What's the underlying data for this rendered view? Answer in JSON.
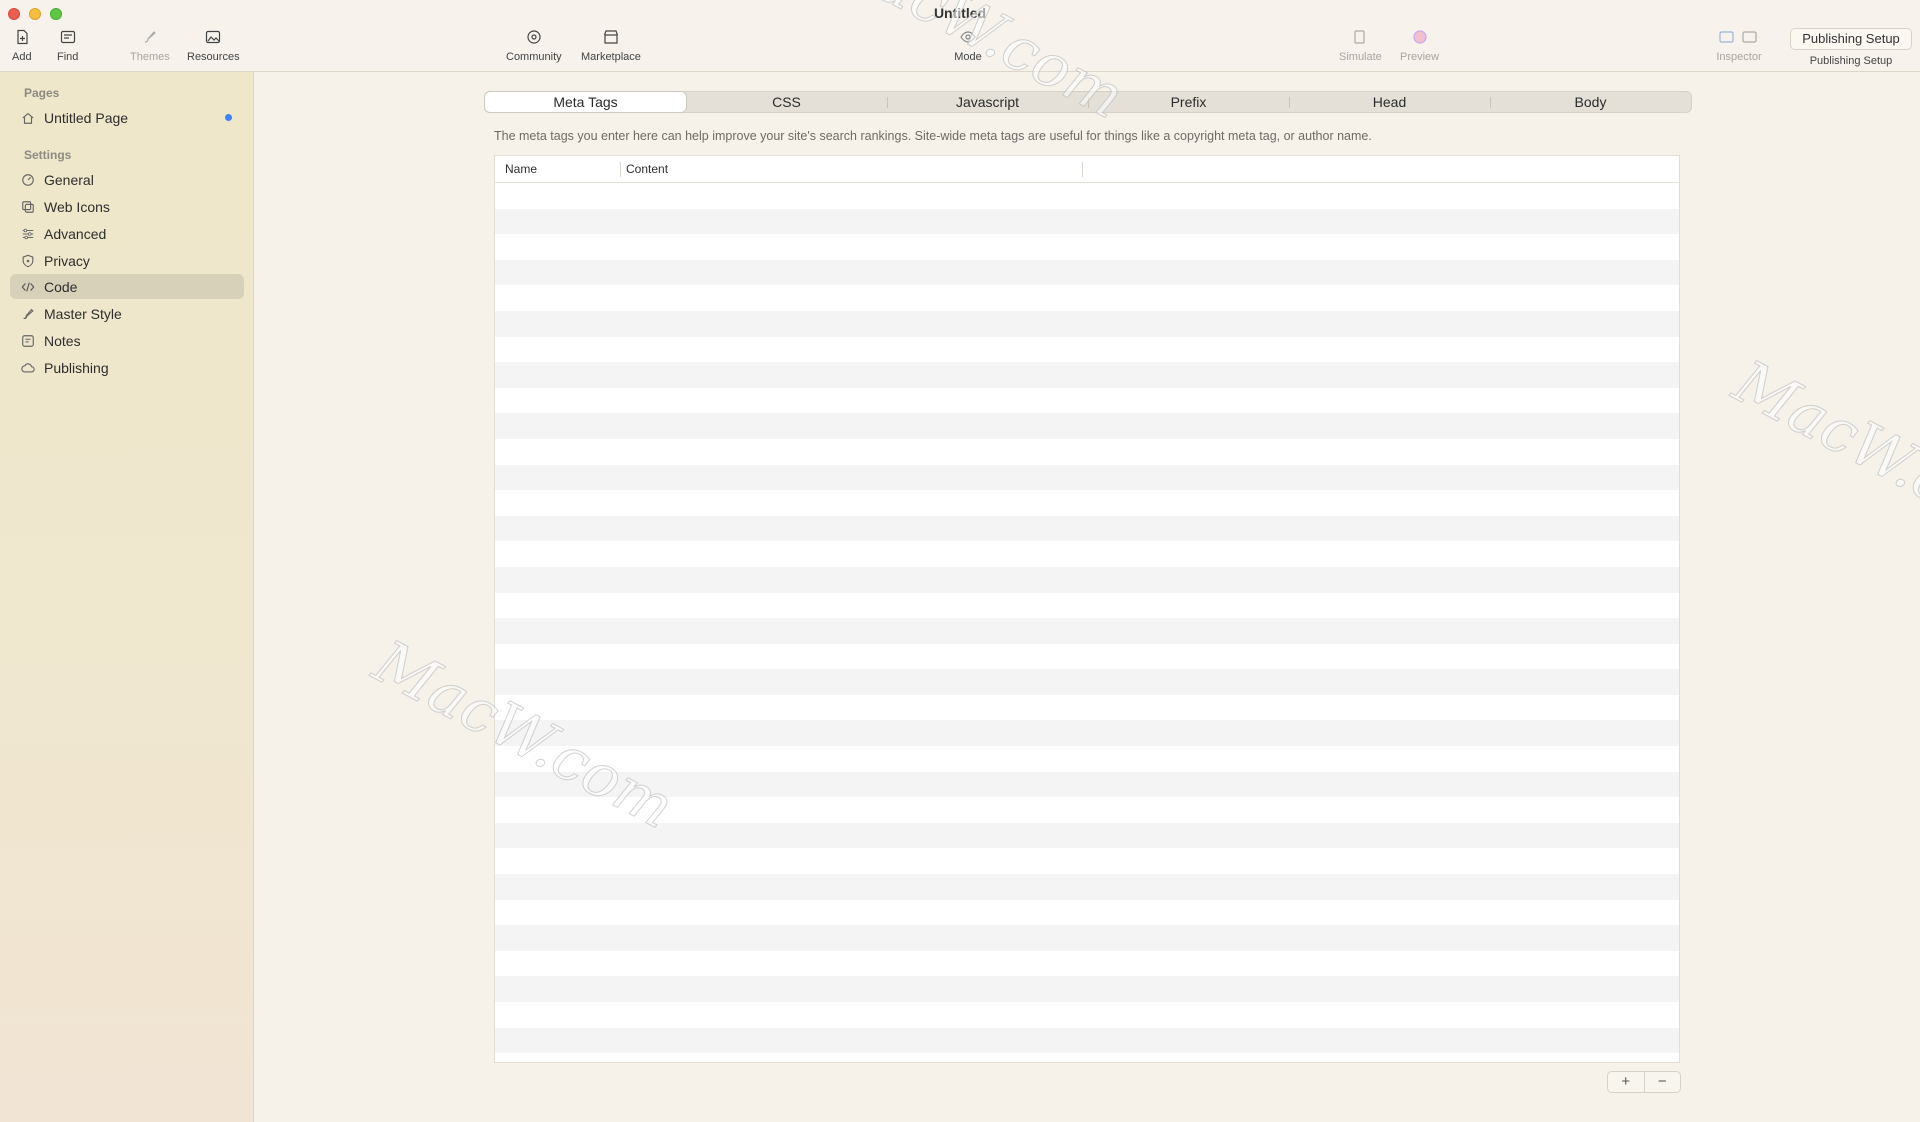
{
  "window": {
    "title": "Untitled"
  },
  "toolbar": {
    "add": "Add",
    "find": "Find",
    "themes": "Themes",
    "resources": "Resources",
    "community": "Community",
    "marketplace": "Marketplace",
    "mode": "Mode",
    "simulate": "Simulate",
    "preview": "Preview",
    "inspector": "Inspector",
    "publishing_setup_button": "Publishing Setup",
    "publishing_setup_caption": "Publishing Setup"
  },
  "sidebar": {
    "pages_header": "Pages",
    "pages": [
      {
        "label": "Untitled Page",
        "icon": "home-icon",
        "has_dot": true
      }
    ],
    "settings_header": "Settings",
    "items": [
      {
        "label": "General",
        "icon": "general-icon"
      },
      {
        "label": "Web Icons",
        "icon": "web-icons-icon"
      },
      {
        "label": "Advanced",
        "icon": "sliders-icon"
      },
      {
        "label": "Privacy",
        "icon": "shield-icon"
      },
      {
        "label": "Code",
        "icon": "code-icon",
        "selected": true
      },
      {
        "label": "Master Style",
        "icon": "brush-icon"
      },
      {
        "label": "Notes",
        "icon": "notes-icon"
      },
      {
        "label": "Publishing",
        "icon": "cloud-icon"
      }
    ]
  },
  "main": {
    "tabs": [
      {
        "label": "Meta Tags",
        "active": true
      },
      {
        "label": "CSS"
      },
      {
        "label": "Javascript"
      },
      {
        "label": "Prefix"
      },
      {
        "label": "Head"
      },
      {
        "label": "Body"
      }
    ],
    "description": "The meta tags you enter here can help improve your site's search rankings. Site-wide meta tags are useful for things like a copyright meta tag, or author name.",
    "table": {
      "columns": [
        "Name",
        "Content",
        ""
      ],
      "rows": []
    },
    "add_label": "+",
    "remove_label": "−"
  },
  "watermark": "MacW.com",
  "colors": {
    "accent": "#3b82f6",
    "sidebar_selected": "#d8d1b9"
  }
}
